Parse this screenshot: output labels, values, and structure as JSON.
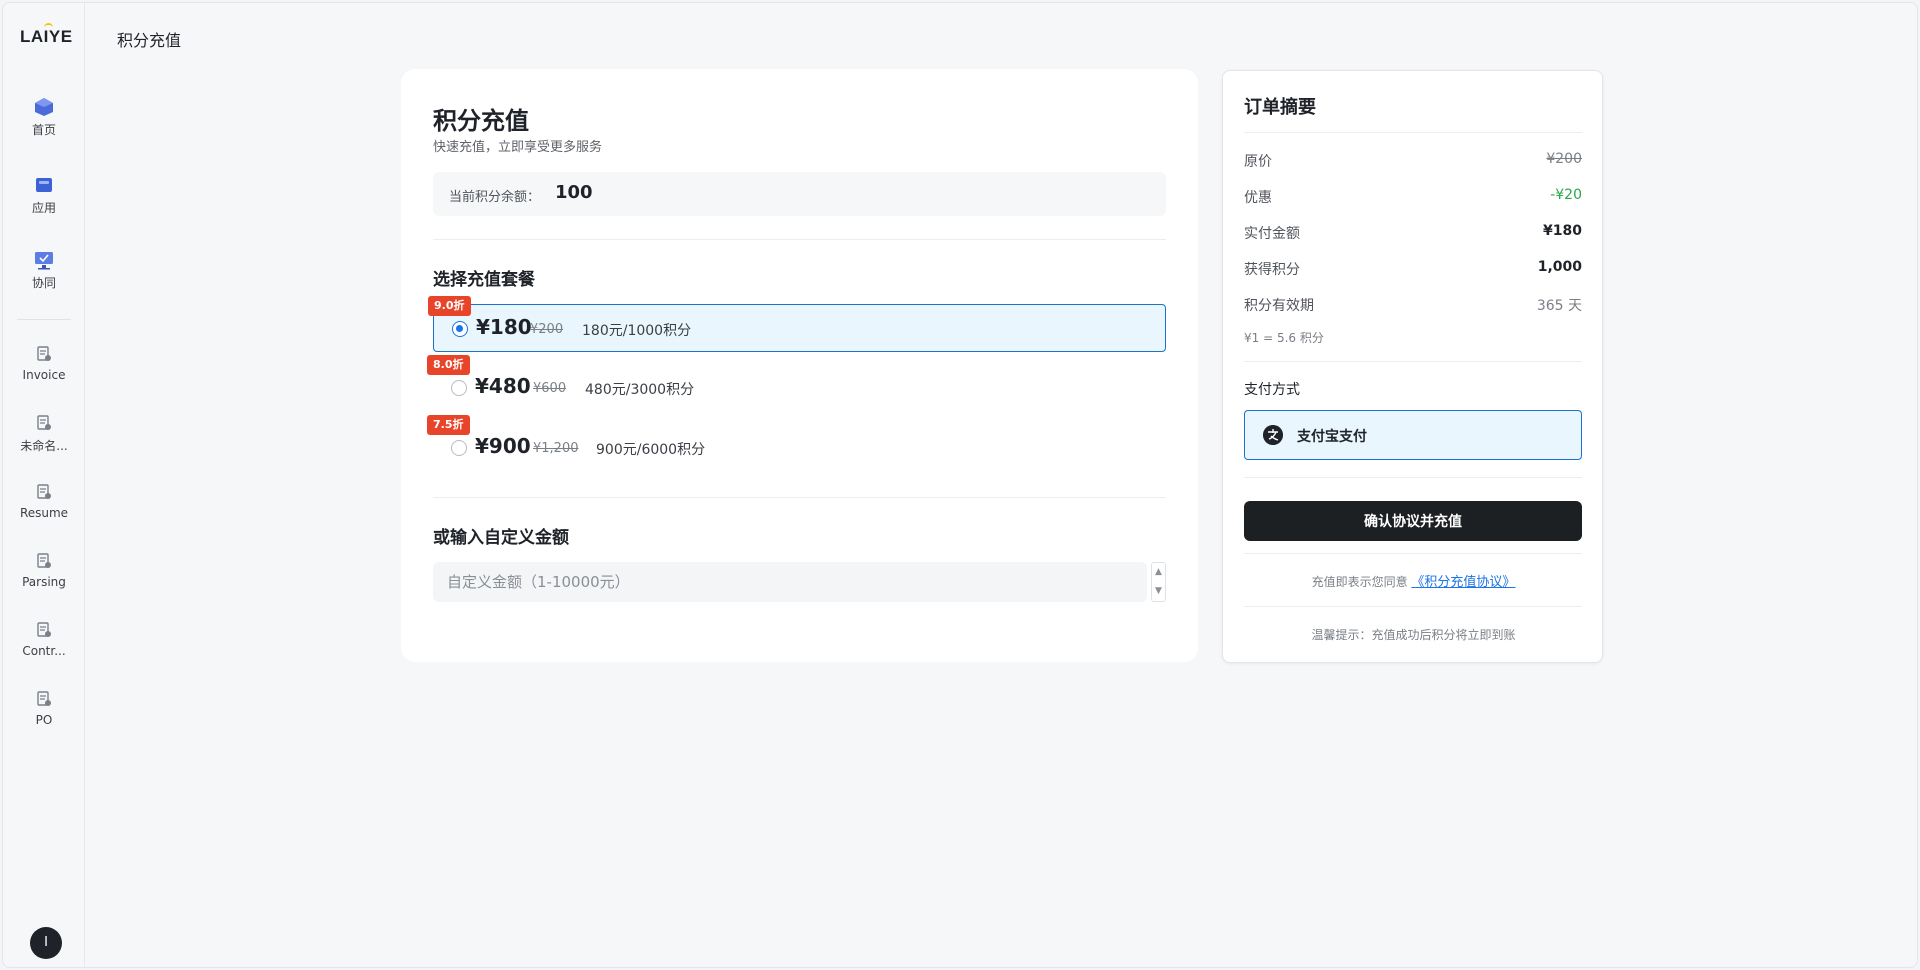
{
  "app": {
    "logo": "LAIYE",
    "page_title": "积分充值"
  },
  "sidebar": {
    "items": [
      {
        "label": "首页",
        "icon": "home-icon"
      },
      {
        "label": "应用",
        "icon": "apps-icon"
      },
      {
        "label": "协同",
        "icon": "collab-icon"
      },
      {
        "label": "Invoice",
        "icon": "document-icon"
      },
      {
        "label": "未命名...",
        "icon": "document-icon"
      },
      {
        "label": "Resume",
        "icon": "document-icon"
      },
      {
        "label": "Parsing",
        "icon": "document-icon"
      },
      {
        "label": "Contr...",
        "icon": "document-icon"
      },
      {
        "label": "PO",
        "icon": "document-icon"
      }
    ],
    "avatar_initial": "I"
  },
  "recharge": {
    "title": "积分充值",
    "subtitle": "快速充值，立即享受更多服务",
    "balance_label": "当前积分余额：",
    "balance_value": "100",
    "packages_title": "选择充值套餐",
    "packages": [
      {
        "badge": "9.0折",
        "price": "¥180",
        "original": "¥200",
        "desc": "180元/1000积分",
        "selected": true
      },
      {
        "badge": "8.0折",
        "price": "¥480",
        "original": "¥600",
        "desc": "480元/3000积分",
        "selected": false
      },
      {
        "badge": "7.5折",
        "price": "¥900",
        "original": "¥1,200",
        "desc": "900元/6000积分",
        "selected": false
      }
    ],
    "custom_title": "或输入自定义金额",
    "custom_placeholder": "自定义金额（1-10000元）",
    "custom_value": ""
  },
  "summary": {
    "title": "订单摘要",
    "rows": [
      {
        "label": "原价",
        "value": "¥200"
      },
      {
        "label": "优惠",
        "value": "-¥20"
      },
      {
        "label": "实付金额",
        "value": "¥180"
      },
      {
        "label": "获得积分",
        "value": "1,000"
      },
      {
        "label": "积分有效期",
        "value": "365 天"
      }
    ],
    "rate": "¥1 = 5.6 积分",
    "payment_label": "支付方式",
    "payment_option": "支付宝支付",
    "confirm_button": "确认协议并充值",
    "agree_prefix": "充值即表示您同意",
    "agree_link": "《积分充值协议》",
    "tip": "温馨提示：充值成功后积分将立即到账"
  },
  "colors": {
    "accent": "#1a73e8",
    "badge": "#e8442a",
    "discount_green": "#2aa84a",
    "button_dark": "#1d2023"
  }
}
